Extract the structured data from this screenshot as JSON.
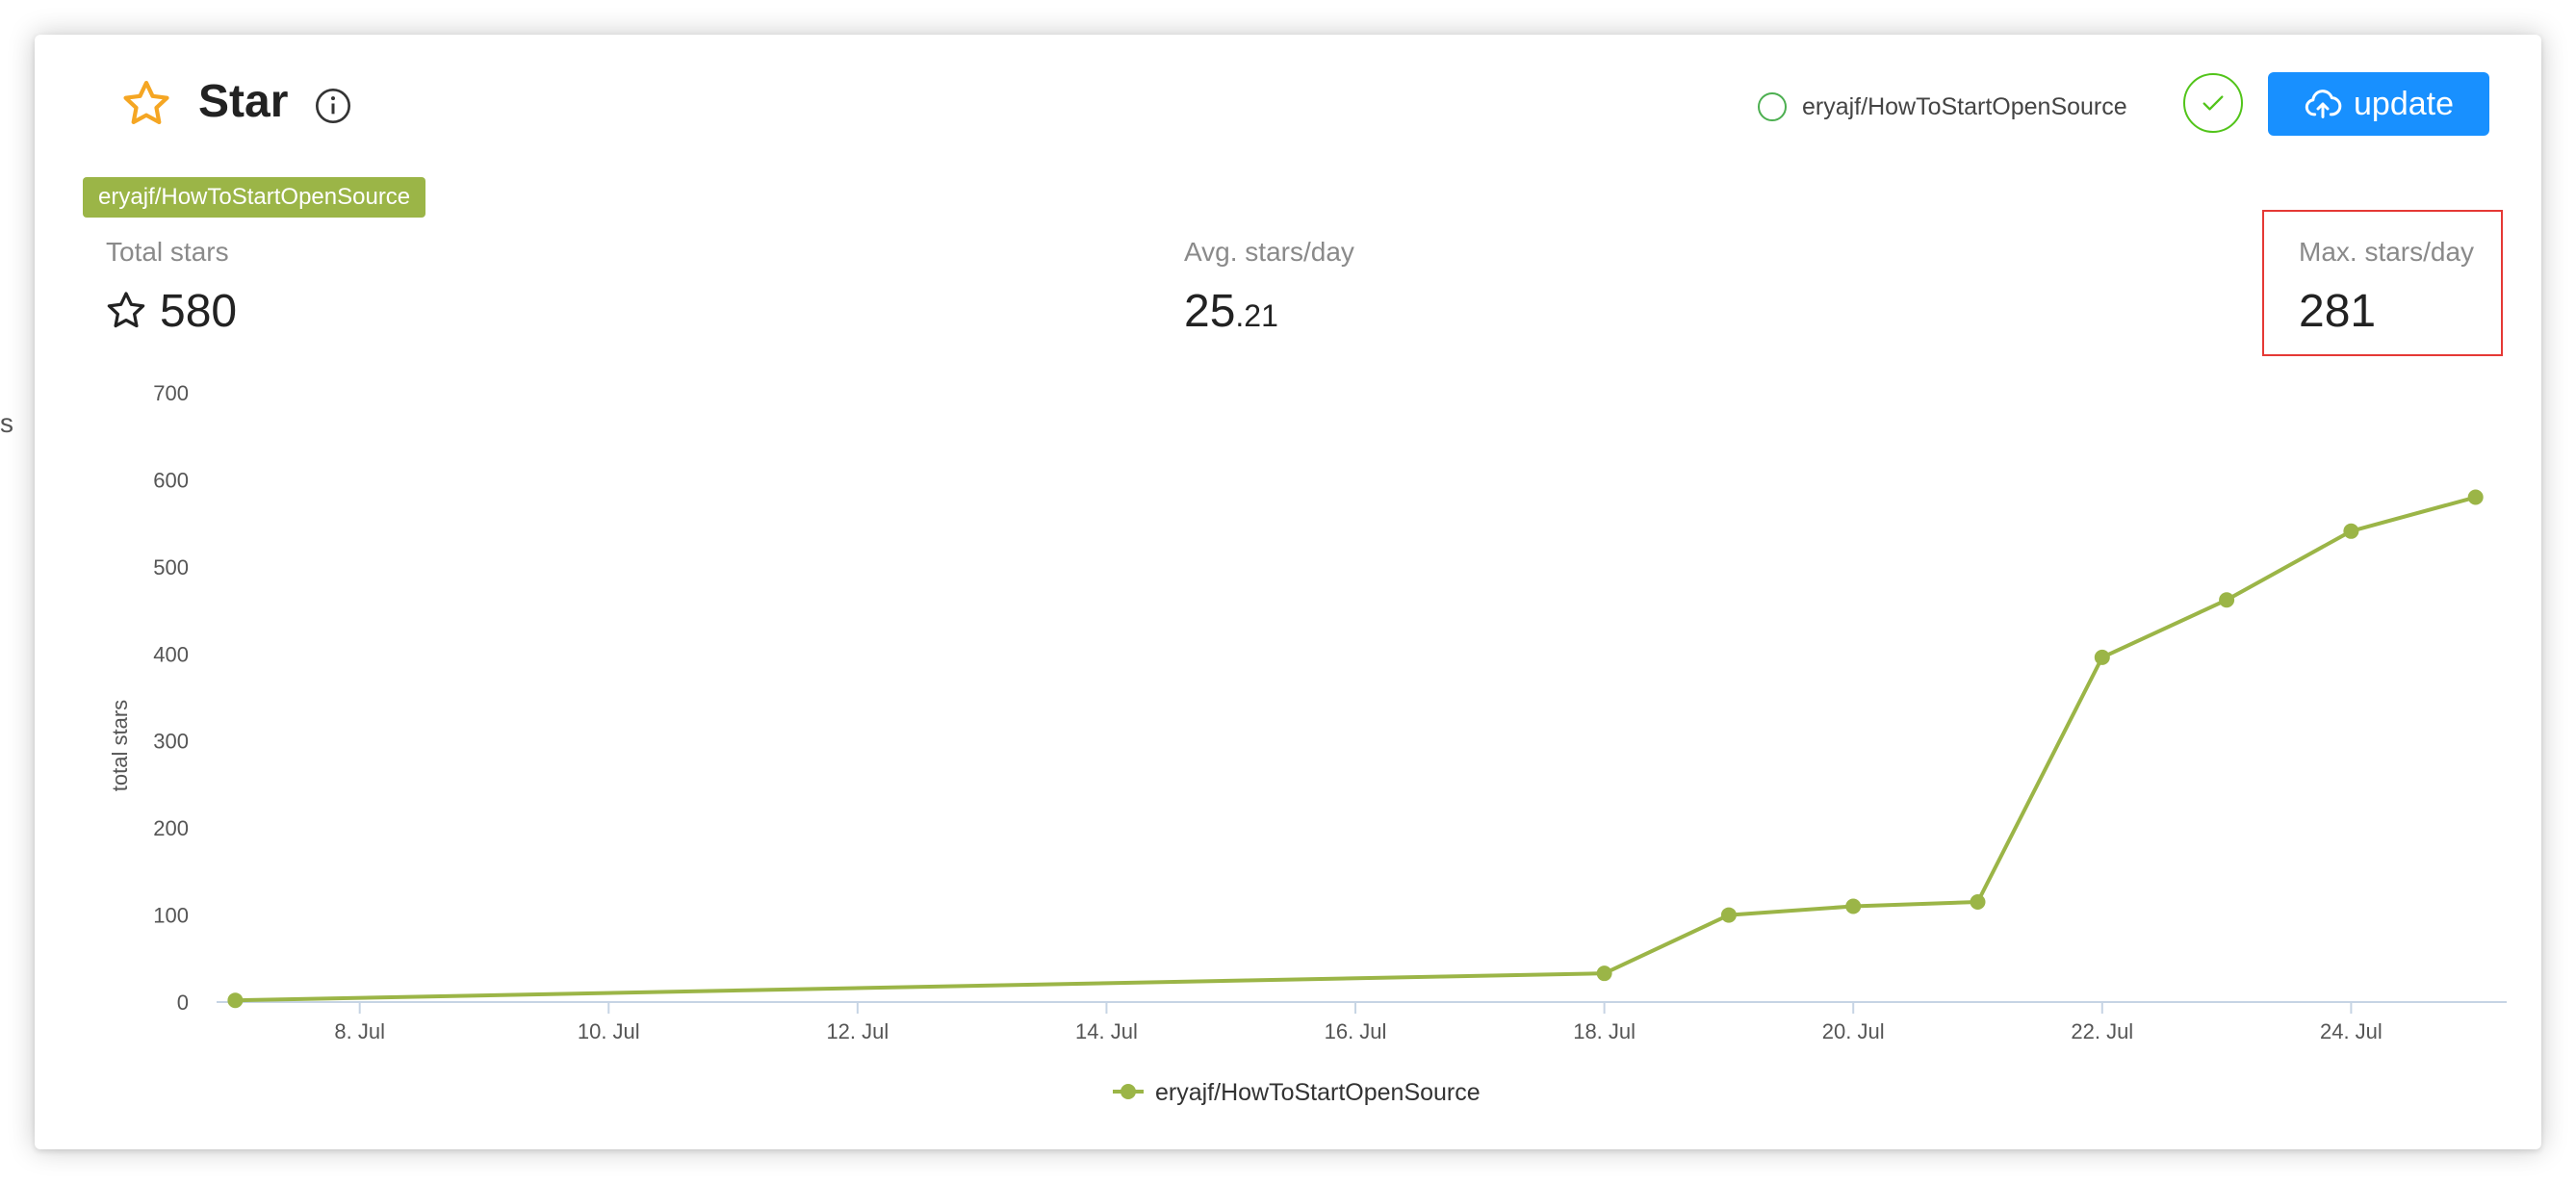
{
  "header": {
    "title": "Star",
    "repo_option": "eryajf/HowToStartOpenSource",
    "update_label": "update"
  },
  "repo_tag": "eryajf/HowToStartOpenSource",
  "stats": {
    "total_label": "Total stars",
    "total_value": "580",
    "avg_label": "Avg. stars/day",
    "avg_int": "25",
    "avg_frac": ".21",
    "max_label": "Max. stars/day",
    "max_value": "281"
  },
  "edge_text": "s",
  "colors": {
    "accent": "#1890ff",
    "series": "#9bb547",
    "success": "#52c41a",
    "highlight_border": "#e53935",
    "star": "#f5a623"
  },
  "icons": {
    "title_icon": "star-outline-icon",
    "info": "info-icon",
    "check": "check-icon",
    "upload": "cloud-upload-icon",
    "total_stat": "star-outline-icon"
  },
  "chart_data": {
    "type": "line",
    "ylabel": "total stars",
    "xlabel": "",
    "ylim": [
      0,
      700
    ],
    "yticks": [
      0,
      100,
      200,
      300,
      400,
      500,
      600,
      700
    ],
    "x_tick_labels": [
      "8. Jul",
      "10. Jul",
      "12. Jul",
      "14. Jul",
      "16. Jul",
      "18. Jul",
      "20. Jul",
      "22. Jul",
      "24. Jul"
    ],
    "x_tick_days": [
      8,
      10,
      12,
      14,
      16,
      18,
      20,
      22,
      24
    ],
    "xlim_days": [
      6.85,
      25.25
    ],
    "grid": false,
    "legend_position": "bottom-center",
    "series": [
      {
        "name": "eryajf/HowToStartOpenSource",
        "x_days": [
          7,
          18,
          19,
          20,
          21,
          22,
          23,
          24,
          25
        ],
        "values": [
          2,
          33,
          100,
          110,
          115,
          396,
          462,
          541,
          580
        ]
      }
    ]
  }
}
